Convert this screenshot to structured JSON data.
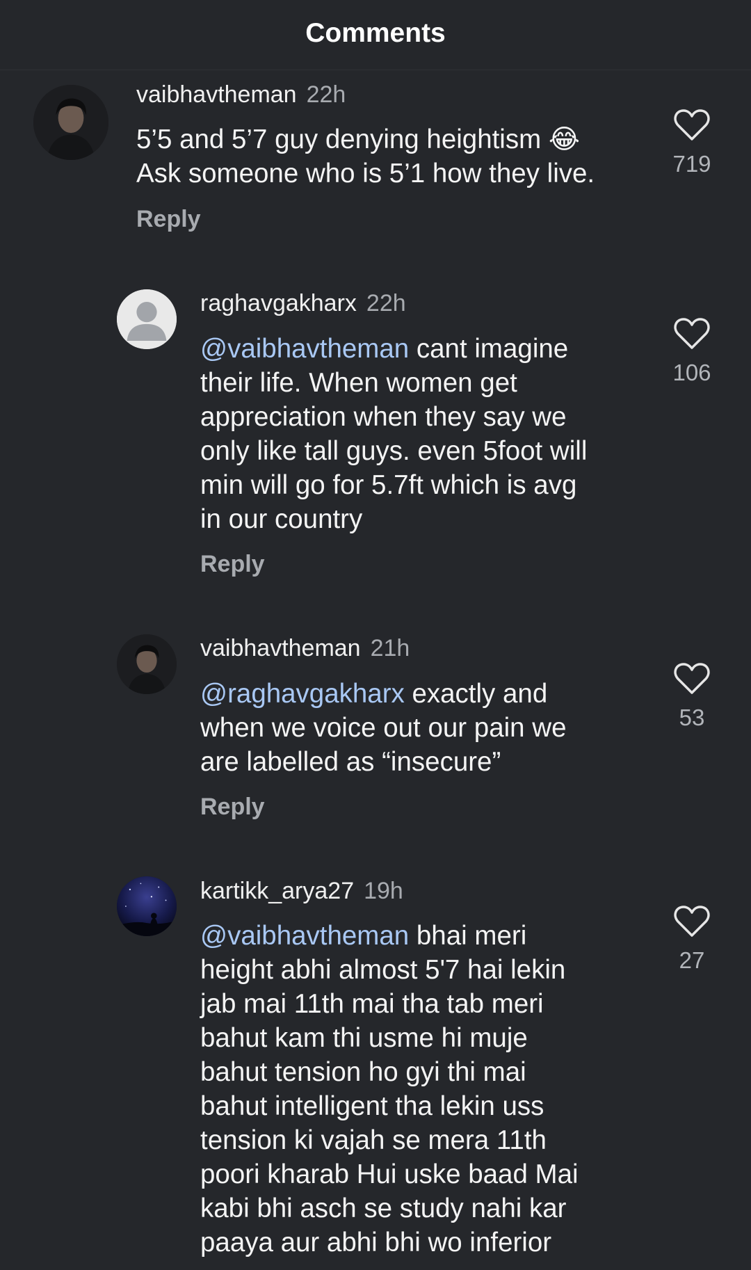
{
  "header": {
    "title": "Comments"
  },
  "comments": [
    {
      "username": "vaibhavtheman",
      "time": "22h",
      "mention": "",
      "text_lines": [
        "5’5 and 5’7 guy denying heightism 😂",
        "Ask someone who is 5’1 how they live."
      ],
      "reply_label": "Reply",
      "likes": "719"
    },
    {
      "username": "raghavgakharx",
      "time": "22h",
      "mention": "@vaibhavtheman",
      "first_line_rest": " cant imagine",
      "text_lines": [
        "their life. When women get",
        "appreciation when they say we",
        "only like tall guys. even 5foot will",
        "min will go for 5.7ft which is avg",
        "in our country"
      ],
      "reply_label": "Reply",
      "likes": "106"
    },
    {
      "username": "vaibhavtheman",
      "time": "21h",
      "mention": "@raghavgakharx",
      "first_line_rest": " exactly and",
      "text_lines": [
        "when we voice out our pain we",
        "are labelled as “insecure”"
      ],
      "reply_label": "Reply",
      "likes": "53"
    },
    {
      "username": "kartikk_arya27",
      "time": "19h",
      "mention": "@vaibhavtheman",
      "first_line_rest": " bhai meri",
      "text_lines": [
        "height abhi almost 5'7 hai lekin",
        "jab mai 11th mai tha tab meri",
        "bahut kam thi usme hi muje",
        "bahut tension ho gyi thi mai",
        "bahut intelligent tha lekin uss",
        "tension ki vajah se mera 11th",
        "poori kharab Hui uske baad Mai",
        "kabi bhi asch se study nahi kar",
        "paaya aur abhi bhi wo inferior"
      ],
      "likes": "27"
    }
  ]
}
